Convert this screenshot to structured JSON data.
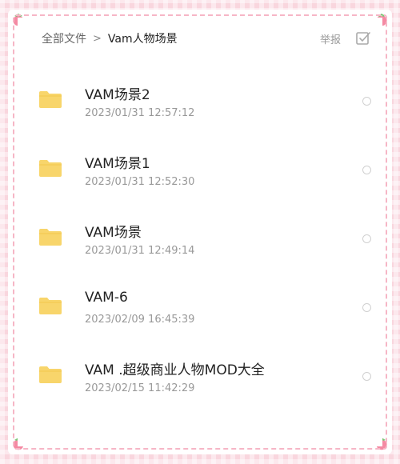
{
  "breadcrumb": {
    "root": "全部文件",
    "separator": ">",
    "current": "Vam人物场景"
  },
  "header": {
    "report_label": "举报",
    "select_all_icon": "checkbox-icon"
  },
  "files": [
    {
      "name": "VAM场景2",
      "time": "2023/01/31 12:57:12",
      "icon": "folder-icon"
    },
    {
      "name": "VAM场景1",
      "time": "2023/01/31 12:52:30",
      "icon": "folder-icon"
    },
    {
      "name": "VAM场景",
      "time": "2023/01/31 12:49:14",
      "icon": "folder-icon"
    },
    {
      "name": "VAM-6",
      "time": "2023/02/09 16:45:39",
      "icon": "folder-icon"
    },
    {
      "name": "VAM .超级商业人物MOD大全",
      "time": "2023/02/15 11:42:29",
      "icon": "folder-icon"
    }
  ],
  "colors": {
    "folder": "#f8d56b",
    "frame_dash": "#f6b6c6",
    "background": "#f9d6de"
  }
}
